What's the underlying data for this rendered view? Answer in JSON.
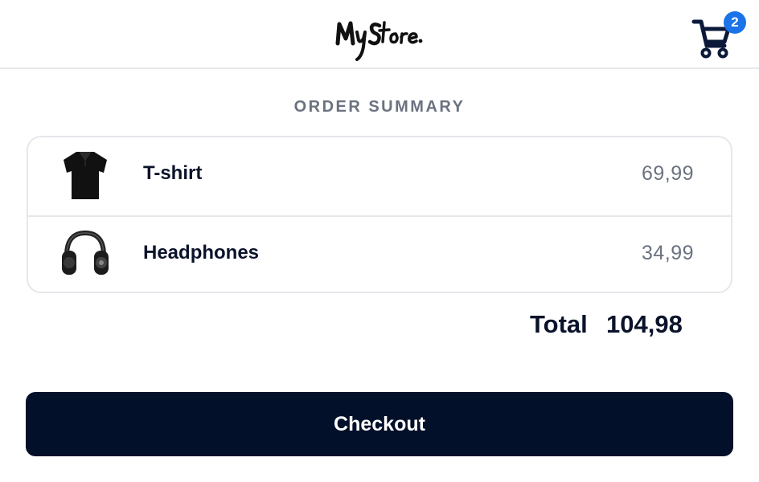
{
  "header": {
    "logo_text": "MyStore.",
    "cart_icon": "shopping-cart-icon",
    "cart_count": "2",
    "badge_color": "#1a73e8"
  },
  "order_summary": {
    "title": "ORDER SUMMARY",
    "items": [
      {
        "name": "T-shirt",
        "price": "69,99",
        "icon": "t-shirt-icon"
      },
      {
        "name": "Headphones",
        "price": "34,99",
        "icon": "headphones-icon"
      }
    ],
    "total_label": "Total",
    "total_value": "104,98"
  },
  "checkout": {
    "label": "Checkout",
    "button_color": "#02102a"
  }
}
